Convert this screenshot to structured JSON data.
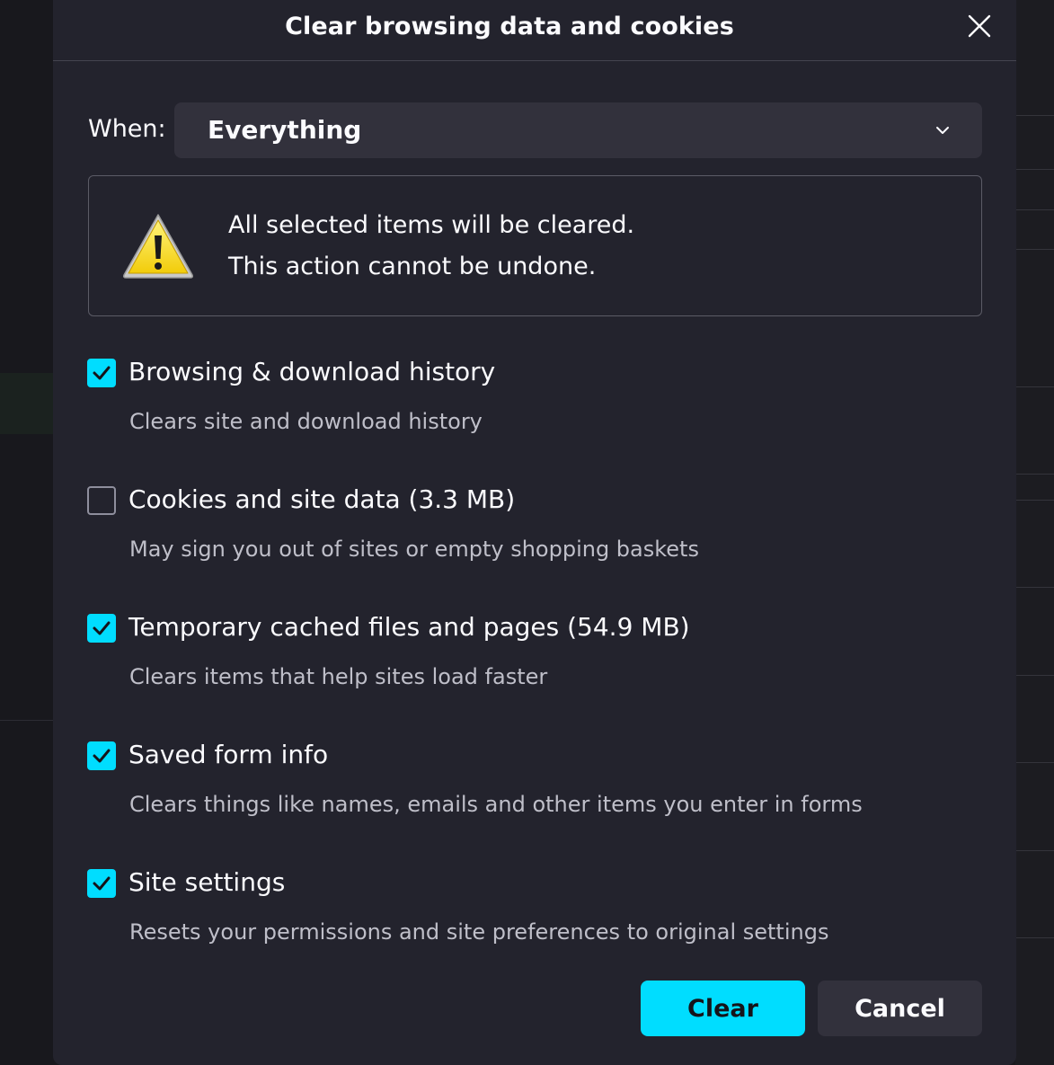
{
  "dialog": {
    "title": "Clear browsing data and cookies",
    "close_icon": "close-icon"
  },
  "when": {
    "label": "When:",
    "selected": "Everything"
  },
  "warning": {
    "icon": "warning-icon",
    "line1": "All selected items will be cleared.",
    "line2": "This action cannot be undone."
  },
  "options": [
    {
      "label": "Browsing & download history",
      "description": "Clears site and download history",
      "checked": true
    },
    {
      "label": "Cookies and site data (3.3 MB)",
      "description": "May sign you out of sites or empty shopping baskets",
      "checked": false
    },
    {
      "label": "Temporary cached files and pages (54.9 MB)",
      "description": "Clears items that help sites load faster",
      "checked": true
    },
    {
      "label": "Saved form info",
      "description": "Clears things like names, emails and other items you enter in forms",
      "checked": true
    },
    {
      "label": "Site settings",
      "description": "Resets your permissions and site preferences to original settings",
      "checked": true
    }
  ],
  "buttons": {
    "clear": "Clear",
    "cancel": "Cancel"
  },
  "colors": {
    "accent": "#00ddff",
    "dialog_bg": "#23232d",
    "text": "#fbfbfe"
  }
}
